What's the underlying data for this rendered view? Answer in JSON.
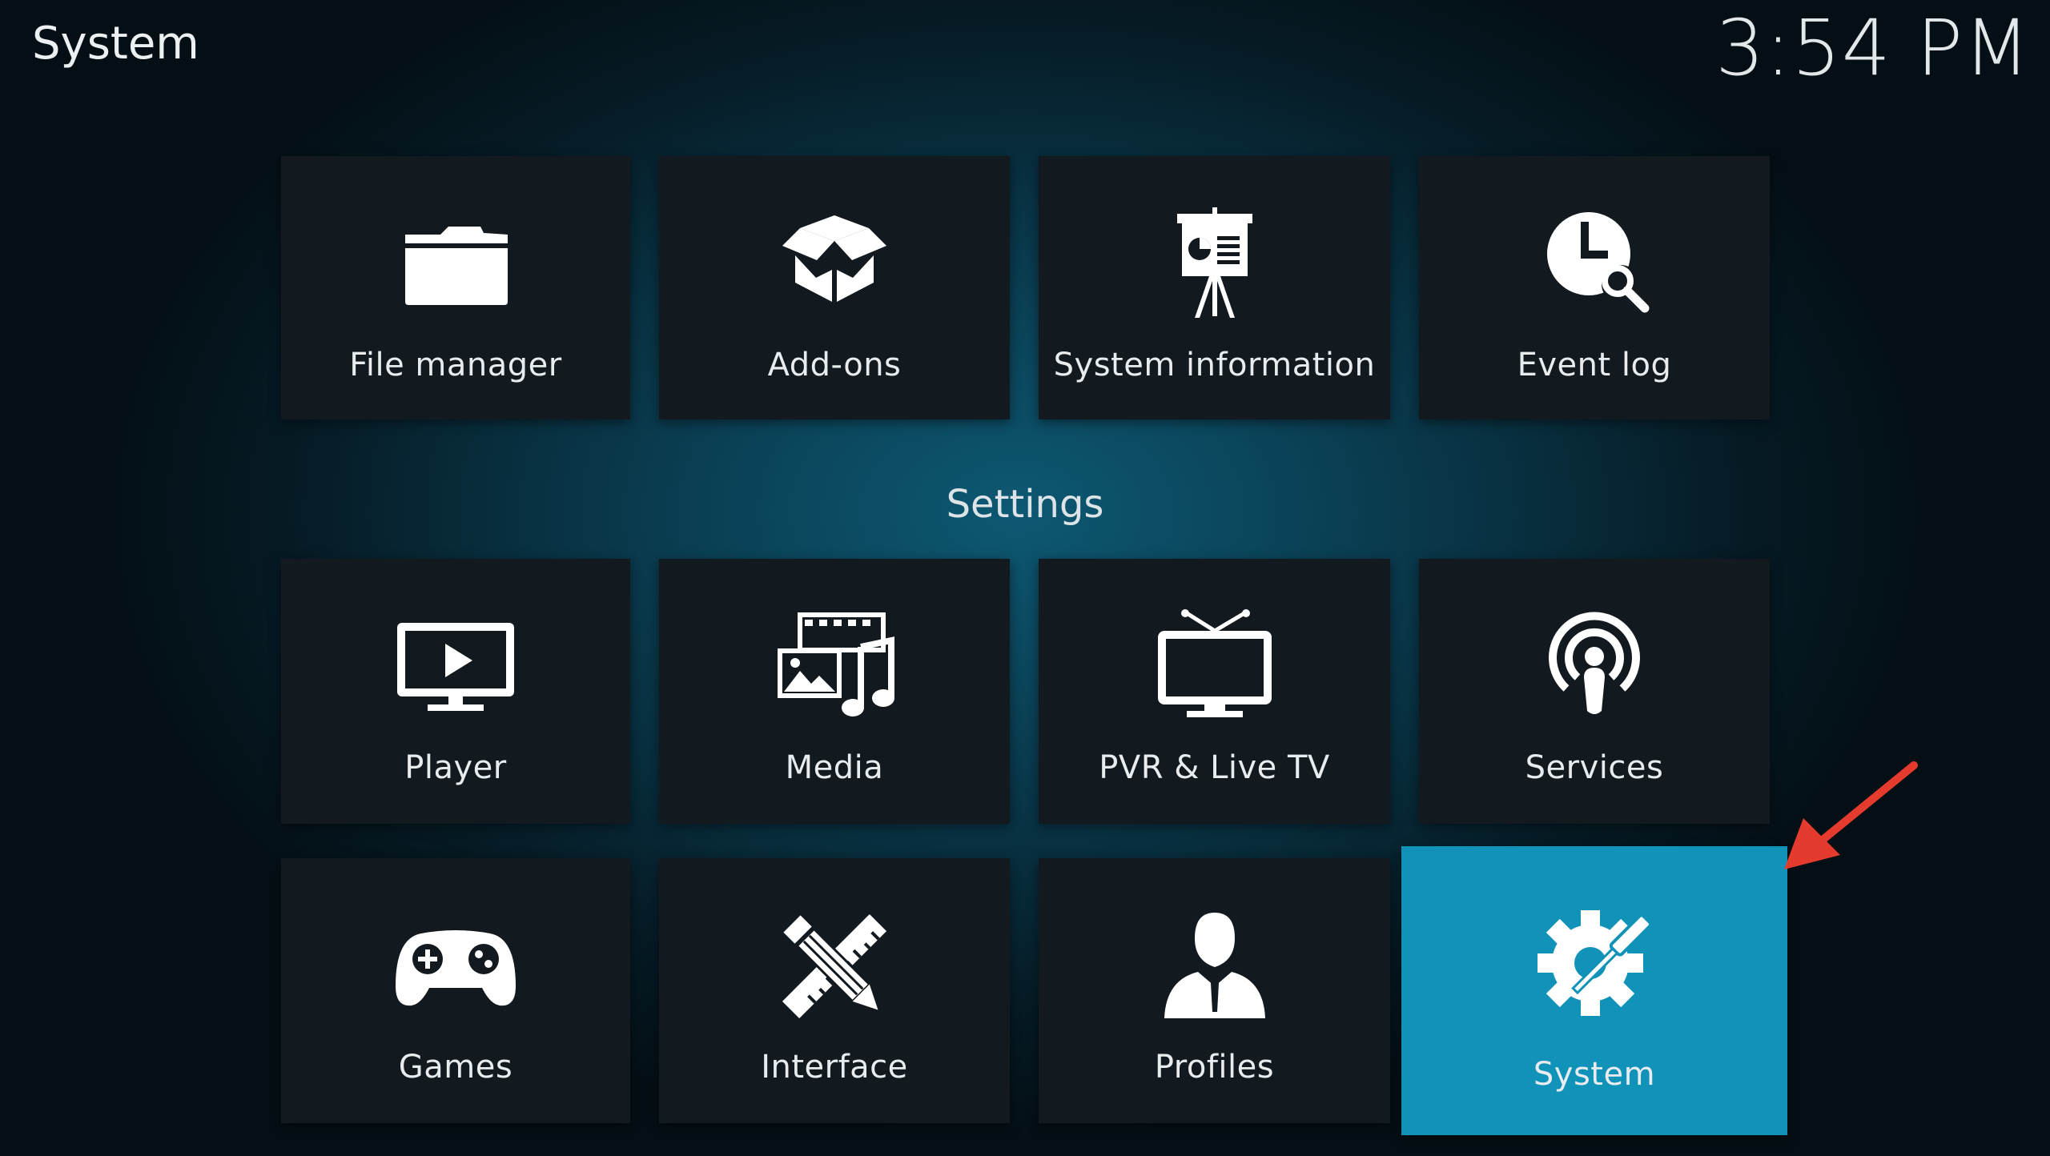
{
  "header": {
    "title": "System",
    "clock": "3:54 PM"
  },
  "top_row": [
    {
      "label": "File manager",
      "icon": "folder-icon"
    },
    {
      "label": "Add-ons",
      "icon": "open-box-icon"
    },
    {
      "label": "System information",
      "icon": "presentation-board-icon"
    },
    {
      "label": "Event log",
      "icon": "clock-search-icon"
    }
  ],
  "settings": {
    "section_label": "Settings",
    "items": [
      {
        "label": "Player",
        "icon": "monitor-play-icon"
      },
      {
        "label": "Media",
        "icon": "media-collage-icon"
      },
      {
        "label": "PVR & Live TV",
        "icon": "tv-antenna-icon"
      },
      {
        "label": "Services",
        "icon": "broadcast-podcast-icon"
      },
      {
        "label": "Games",
        "icon": "gamepad-icon"
      },
      {
        "label": "Interface",
        "icon": "pencil-ruler-icon"
      },
      {
        "label": "Profiles",
        "icon": "person-silhouette-icon"
      },
      {
        "label": "System",
        "icon": "gear-screwdriver-icon",
        "focused": true
      }
    ]
  },
  "colors": {
    "focus": "#1192b8",
    "tile": "#121a1f",
    "annotation_arrow": "#e53a2e"
  }
}
